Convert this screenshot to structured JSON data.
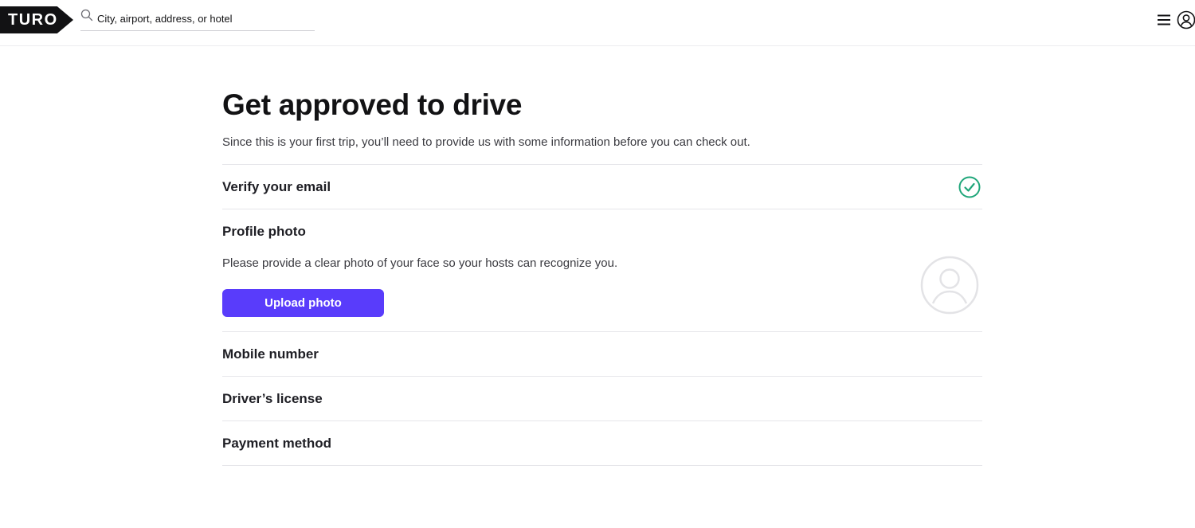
{
  "header": {
    "logo_text": "TURO",
    "search": {
      "placeholder": "City, airport, address, or hotel",
      "value": ""
    },
    "icons": {
      "search": "search-icon",
      "menu": "hamburger-menu-icon",
      "account": "account-icon"
    }
  },
  "main": {
    "title": "Get approved to drive",
    "subtitle": "Since this is your first trip, you’ll need to provide us with some information before you can check out.",
    "steps": [
      {
        "title": "Verify your email",
        "status": "complete",
        "icon": "check-circle-icon"
      },
      {
        "title": "Profile photo",
        "description": "Please provide a clear photo of your face so your hosts can recognize you.",
        "button_label": "Upload photo",
        "icon": "user-avatar-icon"
      },
      {
        "title": "Mobile number"
      },
      {
        "title": "Driver’s license"
      },
      {
        "title": "Payment method"
      }
    ]
  },
  "colors": {
    "accent": "#593cfb",
    "success": "#1fa67a",
    "logo_bg": "#121214",
    "divider": "#e6e6ea"
  }
}
